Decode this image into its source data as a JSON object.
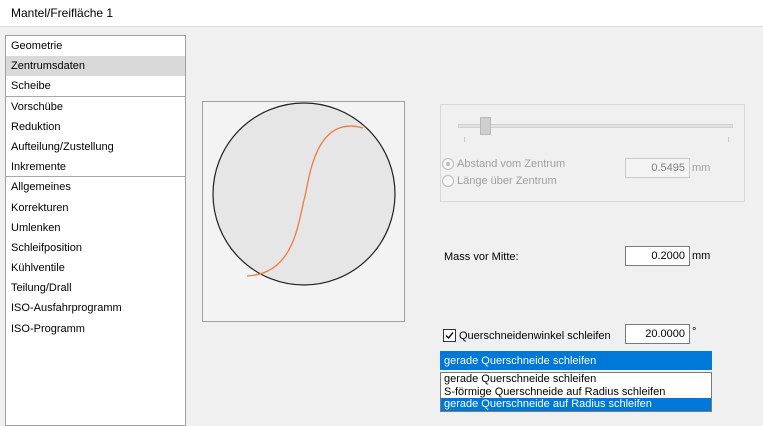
{
  "window": {
    "title": "Mantel/Freifläche 1"
  },
  "sidebar": {
    "items": [
      {
        "label": "Geometrie"
      },
      {
        "label": "Zentrumsdaten"
      },
      {
        "label": "Scheibe"
      },
      {
        "label": "Vorschübe"
      },
      {
        "label": "Reduktion"
      },
      {
        "label": "Aufteilung/Zustellung"
      },
      {
        "label": "Inkremente"
      },
      {
        "label": "Allgemeines"
      },
      {
        "label": "Korrekturen"
      },
      {
        "label": "Umlenken"
      },
      {
        "label": "Schleifposition"
      },
      {
        "label": "Kühlventile"
      },
      {
        "label": "Teilung/Drall"
      },
      {
        "label": "ISO-Ausfahrprogramm"
      },
      {
        "label": "ISO-Programm"
      }
    ],
    "selected_index": 1
  },
  "preview": {
    "curve_color": "#f07b3f"
  },
  "center_group": {
    "slider_position": 0.1,
    "option_distance": "Abstand vom Zentrum",
    "option_length": "Länge über Zentrum",
    "selected_option": "Abstand vom Zentrum",
    "value": "0.5495",
    "unit": "mm"
  },
  "mass_vor_mitte": {
    "label": "Mass vor Mitte:",
    "value": "0.2000",
    "unit": "mm"
  },
  "chisel_angle": {
    "checkbox_label": "Querschneidenwinkel schleifen",
    "checked": true,
    "value": "20.0000",
    "unit": "°"
  },
  "chisel_type": {
    "selected": "gerade Querschneide schleifen",
    "options": [
      "gerade Querschneide schleifen",
      "S-förmige Querschneide auf Radius schleifen",
      "gerade Querschneide auf Radius schleifen"
    ],
    "highlighted_index": 2
  },
  "colors": {
    "accent": "#0078d7",
    "selection_gray": "#d9d9d9"
  }
}
